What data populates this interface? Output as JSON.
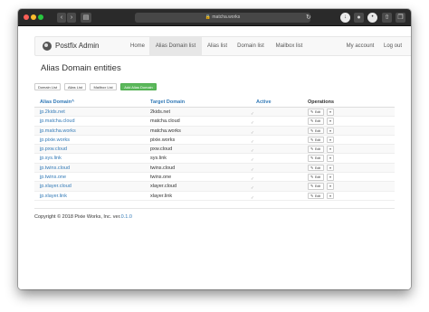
{
  "browser": {
    "url": "matcha.works",
    "lock_icon": "lock-icon"
  },
  "navbar": {
    "brand": "Postfix Admin",
    "items": [
      {
        "label": "Home",
        "active": false
      },
      {
        "label": "Alias Domain list",
        "active": true
      },
      {
        "label": "Alias list",
        "active": false
      },
      {
        "label": "Domain list",
        "active": false
      },
      {
        "label": "Mailbox list",
        "active": false
      }
    ],
    "right_items": [
      {
        "label": "My account"
      },
      {
        "label": "Log out"
      }
    ]
  },
  "page": {
    "title": "Alias Domain entities",
    "buttons": [
      {
        "label": "Domain List"
      },
      {
        "label": "Alias List"
      },
      {
        "label": "Mailbox List"
      },
      {
        "label": "Add Alias Domain"
      }
    ]
  },
  "table": {
    "headers": {
      "alias": "Alias Domain",
      "sort_indicator": "^",
      "target": "Target Domain",
      "active": "Active",
      "operations": "Operations"
    },
    "edit_label": "Edit",
    "rows": [
      {
        "alias": "jp.2kids.net",
        "target": "2kids.net",
        "active": "✓"
      },
      {
        "alias": "jp.matcha.cloud",
        "target": "matcha.cloud",
        "active": "✓"
      },
      {
        "alias": "jp.matcha.works",
        "target": "matcha.works",
        "active": "✓"
      },
      {
        "alias": "jp.pixie.works",
        "target": "pixie.works",
        "active": "✓"
      },
      {
        "alias": "jp.pxw.cloud",
        "target": "pxw.cloud",
        "active": "✓"
      },
      {
        "alias": "jp.sys.link",
        "target": "sys.link",
        "active": "✓"
      },
      {
        "alias": "jp.twins.cloud",
        "target": "twins.cloud",
        "active": "✓"
      },
      {
        "alias": "jp.twins.one",
        "target": "twins.one",
        "active": "✓"
      },
      {
        "alias": "jp.xlayer.cloud",
        "target": "xlayer.cloud",
        "active": "✓"
      },
      {
        "alias": "jp.xlayer.link",
        "target": "xlayer.link",
        "active": "✓"
      }
    ]
  },
  "footer": {
    "text": "Copyright © 2018 Pixie Works, Inc. ver.",
    "version": "0.1.0"
  },
  "colors": {
    "link": "#337ab7",
    "success": "#5cb85c",
    "titlebar": "#2a2a2a"
  }
}
